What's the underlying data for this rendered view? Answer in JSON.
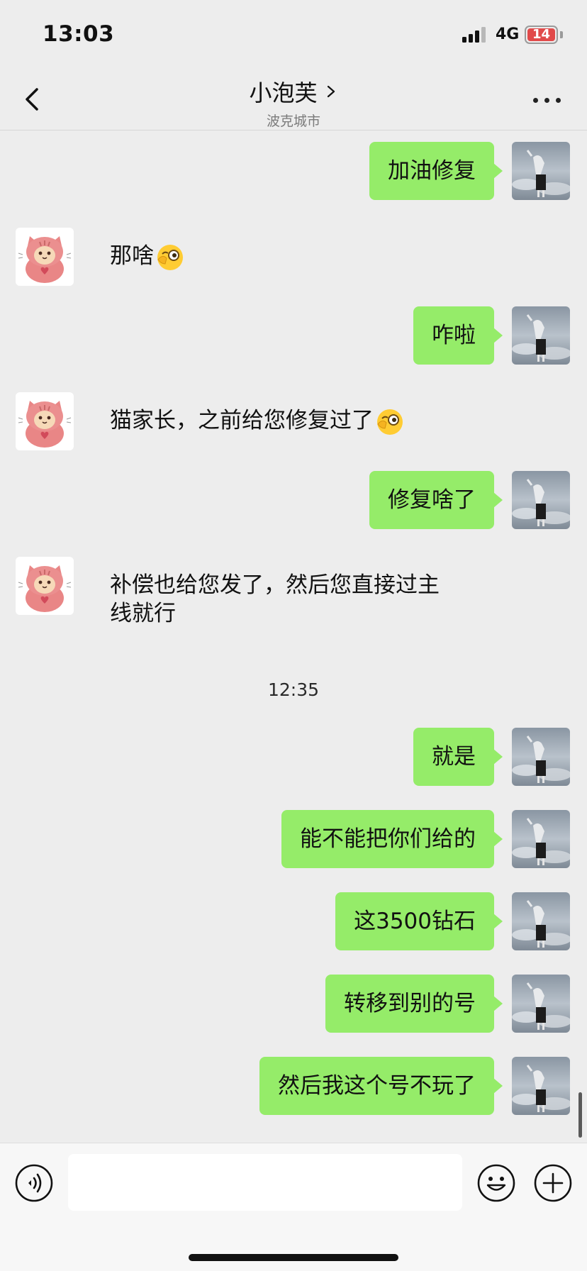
{
  "status_bar": {
    "time": "13:03",
    "network": "4G",
    "battery": "14"
  },
  "header": {
    "title": "小泡芙",
    "subtitle": "波克城市"
  },
  "messages": [
    {
      "sender": "me",
      "text": "加油修复"
    },
    {
      "sender": "other",
      "text": "那啥",
      "emoji": "smirk-monocle-emoji"
    },
    {
      "sender": "me",
      "text": "咋啦"
    },
    {
      "sender": "other",
      "text": "猫家长，之前给您修复过了",
      "emoji": "smirk-monocle-emoji"
    },
    {
      "sender": "me",
      "text": "修复啥了"
    },
    {
      "sender": "other",
      "line1": "补偿也给您发了，然后您直接过主",
      "line2": "线就行"
    },
    {
      "timestamp": "12:35"
    },
    {
      "sender": "me",
      "text": "就是"
    },
    {
      "sender": "me",
      "text": "能不能把你们给的"
    },
    {
      "sender": "me",
      "text": "这3500钻石"
    },
    {
      "sender": "me",
      "text": "转移到别的号"
    },
    {
      "sender": "me",
      "text": "然后我这个号不玩了"
    }
  ],
  "input_bar": {
    "placeholder": ""
  },
  "icons": {
    "back": "chevron-left-icon",
    "more": "more-dots-icon",
    "voice": "voice-icon",
    "emoji": "emoji-face-icon",
    "plus": "plus-circle-icon"
  },
  "colors": {
    "my_bubble": "#95ec69",
    "background": "#ededed",
    "battery_low": "#e14a4a"
  }
}
